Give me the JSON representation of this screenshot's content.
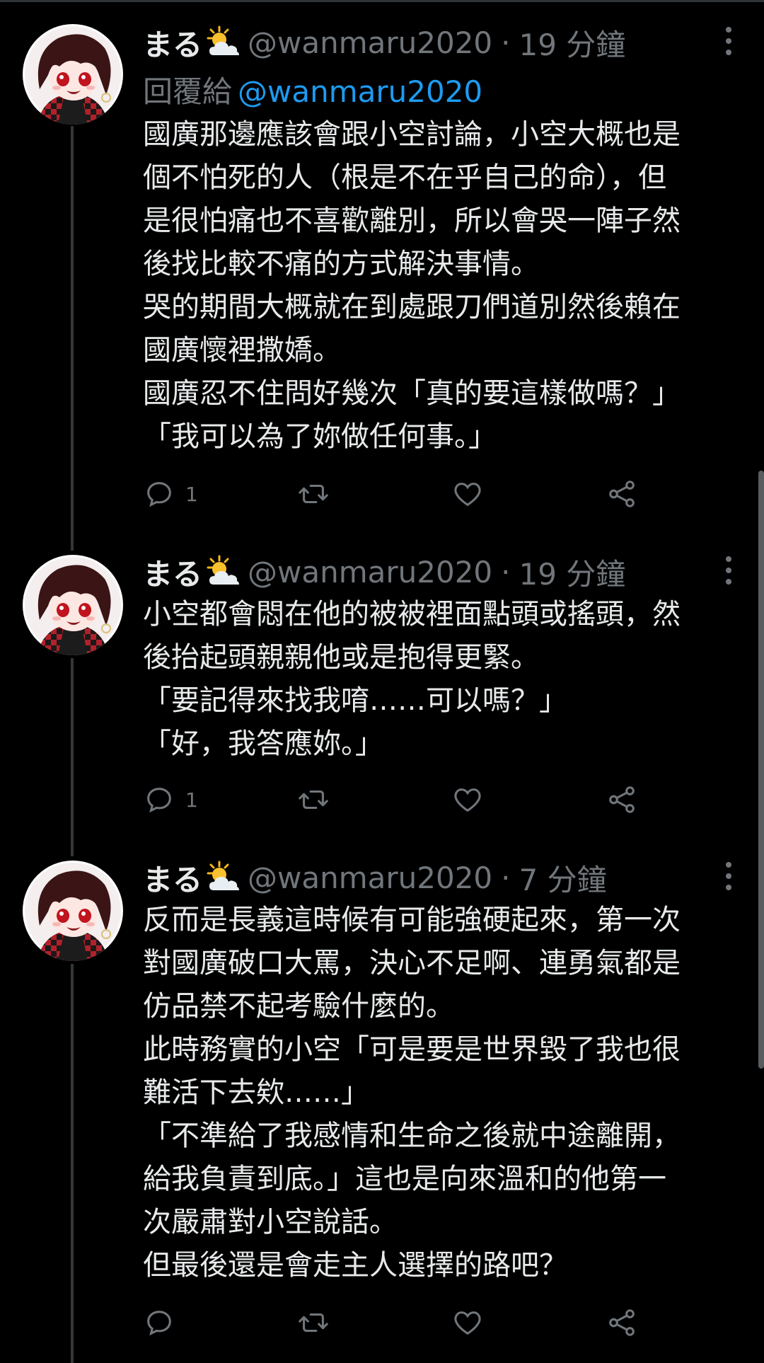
{
  "tweets": [
    {
      "display_name": "まる",
      "weather_icon": "sun-behind-cloud-icon",
      "handle": "@wanmaru2020",
      "separator": "·",
      "time": "19 分鐘",
      "reply_prefix": "回覆給",
      "reply_mention": "@wanmaru2020",
      "lines": [
        "國廣那邊應該會跟小空討論，小空大概也是",
        "個不怕死的人（根是不在乎自己的命），但",
        "是很怕痛也不喜歡離別，所以會哭一陣子然",
        "後找比較不痛的方式解決事情。",
        "哭的期間大概就在到處跟刀們道別然後賴在",
        "國廣懷裡撒嬌。",
        "國廣忍不住問好幾次「真的要這樣做嗎？」",
        "「我可以為了妳做任何事。」"
      ],
      "reply_count": "1",
      "retweet_count": "",
      "like_count": ""
    },
    {
      "display_name": "まる",
      "weather_icon": "sun-behind-cloud-icon",
      "handle": "@wanmaru2020",
      "separator": "·",
      "time": "19 分鐘",
      "lines": [
        "小空都會悶在他的被被裡面點頭或搖頭，然",
        "後抬起頭親親他或是抱得更緊。",
        "「要記得來找我唷……可以嗎？」",
        "「好，我答應妳。」"
      ],
      "reply_count": "1",
      "retweet_count": "",
      "like_count": ""
    },
    {
      "display_name": "まる",
      "weather_icon": "sun-behind-cloud-icon",
      "handle": "@wanmaru2020",
      "separator": "·",
      "time": "7 分鐘",
      "lines": [
        "反而是長義這時候有可能強硬起來，第一次",
        "對國廣破口大罵，決心不足啊、連勇氣都是",
        "仿品禁不起考驗什麼的。",
        "此時務實的小空「可是要是世界毀了我也很",
        "難活下去欸……」",
        "「不準給了我感情和生命之後就中途離開，",
        "給我負責到底。」這也是向來溫和的他第一",
        "次嚴肅對小空說話。",
        "但最後還是會走主人選擇的路吧？"
      ],
      "reply_count": "",
      "retweet_count": "",
      "like_count": ""
    }
  ],
  "colors": {
    "background": "#000000",
    "primary_text": "#e7e9ea",
    "secondary_text": "#71767b",
    "mention": "#1d9bf0",
    "thread_line": "#333639"
  }
}
